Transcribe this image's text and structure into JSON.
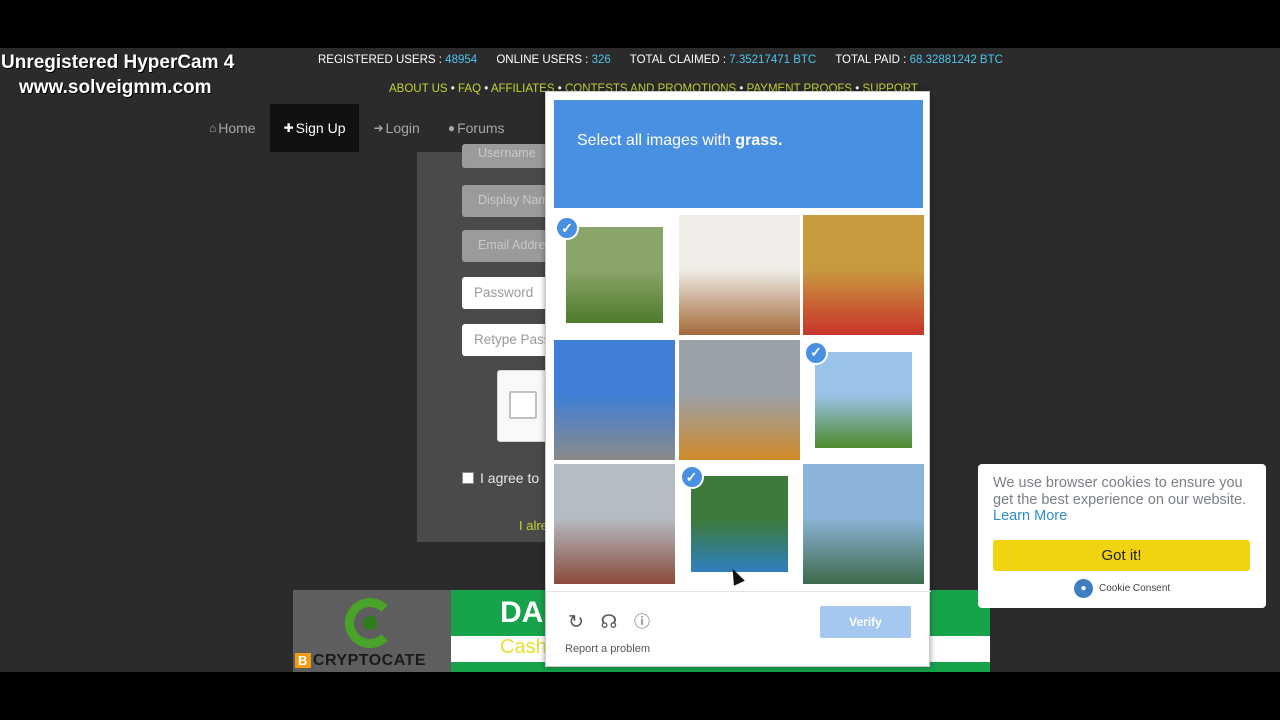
{
  "watermark": {
    "line1": "Unregistered HyperCam 4",
    "line2": "www.solveigmm.com"
  },
  "stats": {
    "registered_label": "REGISTERED USERS :",
    "registered_value": "48954",
    "online_label": "ONLINE USERS :",
    "online_value": "326",
    "claimed_label": "TOTAL CLAIMED :",
    "claimed_value": "7.35217471 BTC",
    "paid_label": "TOTAL PAID :",
    "paid_value": "68.32881242 BTC"
  },
  "links": {
    "about": "ABOUT US",
    "faq": "FAQ",
    "affiliates": "AFFILIATES",
    "contests": "CONTESTS AND PROMOTIONS",
    "proofs": "PAYMENT PROOFS",
    "support": "SUPPORT",
    "separator": "•"
  },
  "nav": {
    "home": "Home",
    "signup": "Sign Up",
    "login": "Login",
    "forums": "Forums"
  },
  "form": {
    "username_ph": "Username",
    "display_ph": "Display Name",
    "email_ph": "Email Address",
    "password_ph": "Password",
    "retype_ph": "Retype Password",
    "agree": "I agree to",
    "already": "I already"
  },
  "banner": {
    "logo_b": "B",
    "logo_text": "CRYPTOCATE",
    "headline": "DA",
    "subline": "Cash"
  },
  "captcha": {
    "prompt_prefix": "Select all images with ",
    "prompt_subject": "grass.",
    "report": "Report a problem",
    "verify": "Verify",
    "tiles": [
      {
        "name": "tile-lake-meadow",
        "selected": true,
        "color_a": "#8aa56a",
        "color_b": "#4f7a2b"
      },
      {
        "name": "tile-basket-rolls",
        "selected": false,
        "color_a": "#f0ede8",
        "color_b": "#a46a3a"
      },
      {
        "name": "tile-fruit-stand",
        "selected": false,
        "color_a": "#c89a3e",
        "color_b": "#c8342b"
      },
      {
        "name": "tile-building",
        "selected": false,
        "color_a": "#3f7fd8",
        "color_b": "#8a8a8a"
      },
      {
        "name": "tile-street-tram",
        "selected": false,
        "color_a": "#9aa1a8",
        "color_b": "#d08a2a"
      },
      {
        "name": "tile-green-hills",
        "selected": true,
        "color_a": "#9ac3e8",
        "color_b": "#4e8a2c"
      },
      {
        "name": "tile-old-street",
        "selected": false,
        "color_a": "#b5bcc4",
        "color_b": "#8a4a3a"
      },
      {
        "name": "tile-pool-lawn",
        "selected": true,
        "color_a": "#3d7a3a",
        "color_b": "#2f7fc0"
      },
      {
        "name": "tile-crater-lake",
        "selected": false,
        "color_a": "#8bb4d8",
        "color_b": "#3e6a4a"
      }
    ]
  },
  "cookie": {
    "message": "We use browser cookies to ensure you get the best experience on our website.",
    "learn_more": "Learn More",
    "got_it": "Got it!",
    "brand": "Cookie Consent"
  }
}
